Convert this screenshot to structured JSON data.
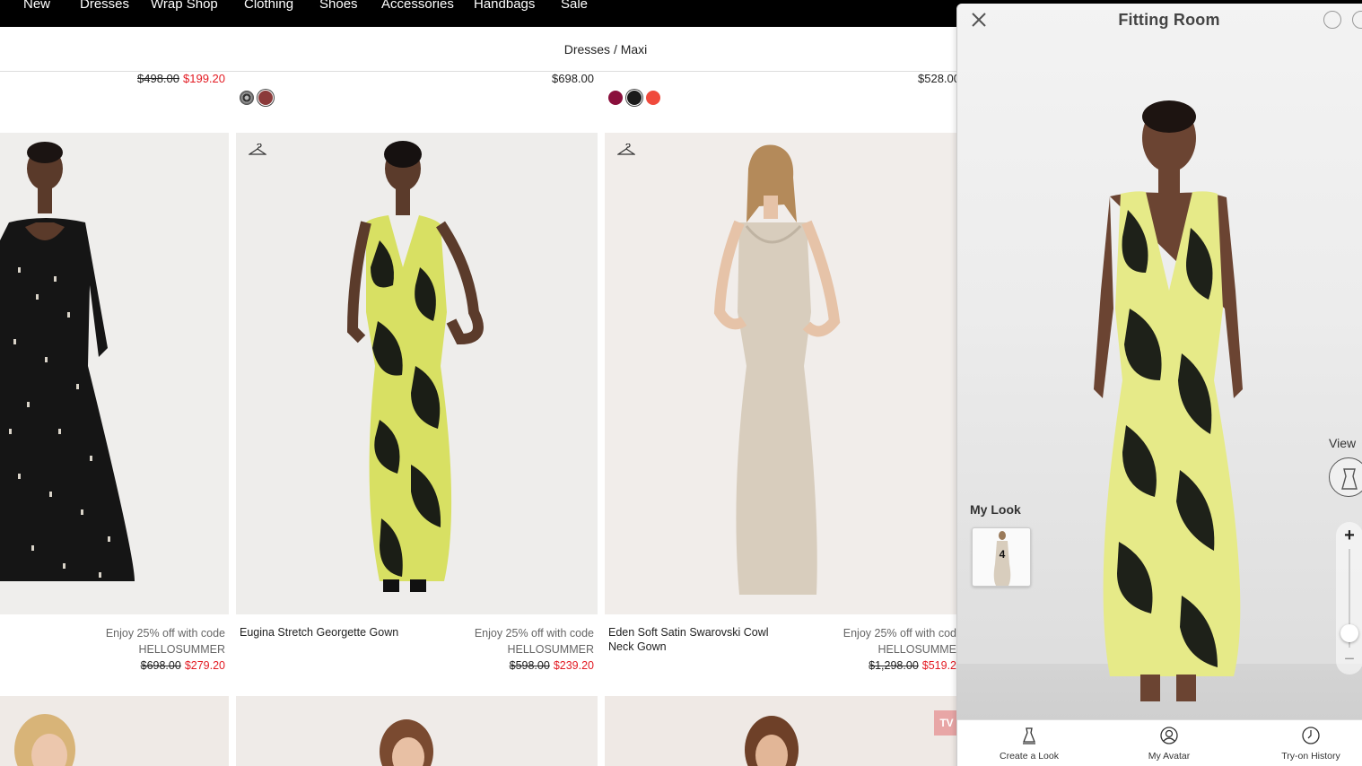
{
  "nav": {
    "items": [
      "New",
      "Dresses",
      "Wrap Shop",
      "Clothing",
      "Shoes",
      "Accessories",
      "Handbags",
      "Sale"
    ]
  },
  "breadcrumb": "Dresses / Maxi",
  "top_row": {
    "col1": {
      "original": "$498.00",
      "sale": "$199.20"
    },
    "col2": {
      "price": "$698.00"
    },
    "col3": {
      "price": "$528.00"
    }
  },
  "colors": {
    "sale_red": "#e31b23",
    "swatch_burgundy": "#8a0f3c",
    "swatch_black": "#1a1a1a",
    "swatch_coral": "#f04a3c"
  },
  "products": [
    {
      "name": "",
      "promo": "Enjoy 25% off with code",
      "code": "HELLOSUMMER",
      "original": "$698.00",
      "sale": "$279.20"
    },
    {
      "name": "Eugina Stretch Georgette Gown",
      "promo": "Enjoy 25% off with code",
      "code": "HELLOSUMMER",
      "original": "$598.00",
      "sale": "$239.20"
    },
    {
      "name": "Eden Soft Satin Swarovski Cowl Neck Gown",
      "promo": "Enjoy 25% off with cod",
      "code": "HELLOSUMME",
      "original": "$1,298.00",
      "sale": "$519.2"
    }
  ],
  "badge_tv": "TV",
  "fitting_room": {
    "title": "Fitting Room",
    "my_look": "My Look",
    "look_count": "4",
    "view_label": "View",
    "zoom_plus": "+",
    "zoom_minus": "−",
    "zoom_level": 0.15,
    "tabs": [
      "Create a Look",
      "My Avatar",
      "Try-on History"
    ]
  }
}
